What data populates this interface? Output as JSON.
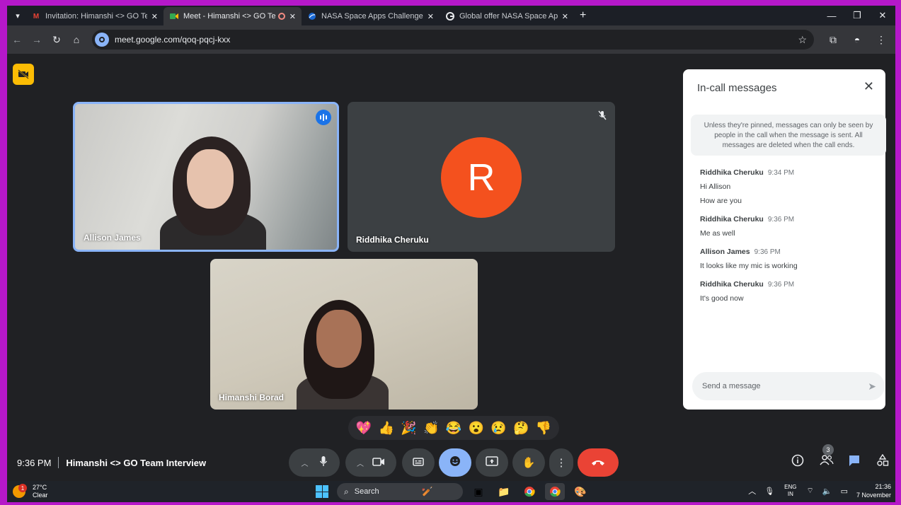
{
  "browser": {
    "tabs": [
      {
        "label": "Invitation: Himanshi <> GO Te",
        "icon": "gmail-icon",
        "active": false,
        "close": "✕"
      },
      {
        "label": "Meet - Himanshi <> GO Te",
        "icon": "meet-icon",
        "active": true,
        "close": "✕"
      },
      {
        "label": "NASA Space Apps Challenge",
        "icon": "nasa-icon",
        "active": false,
        "close": "✕"
      },
      {
        "label": "Global offer NASA Space Apps",
        "icon": "google-icon",
        "active": false,
        "close": "✕"
      }
    ],
    "url": "meet.google.com/qoq-pqcj-kxx"
  },
  "meet": {
    "participants": [
      {
        "name": "Allison James",
        "status": "speaking"
      },
      {
        "name": "Riddhika Cheruku",
        "status": "muted",
        "avatar_letter": "R",
        "avatar_color": "#f4511e"
      },
      {
        "name": "Himanshi Borad",
        "status": "camera-on"
      }
    ],
    "reactions": [
      "💖",
      "👍",
      "🎉",
      "👏",
      "😂",
      "😮",
      "😢",
      "🤔",
      "👎"
    ],
    "time": "9:36 PM",
    "meeting_name": "Himanshi <> GO Team Interview",
    "people_count": "3",
    "accent_color": "#8ab4f8",
    "end_call_color": "#ea4335"
  },
  "chat": {
    "title": "In-call messages",
    "note": "Unless they're pinned, messages can only be seen by people in the call when the message is sent. All messages are deleted when the call ends.",
    "messages": [
      {
        "sender": "Riddhika Cheruku",
        "time": "9:34 PM",
        "lines": [
          "Hi Allison",
          "How are you"
        ]
      },
      {
        "sender": "Riddhika Cheruku",
        "time": "9:36 PM",
        "lines": [
          "Me as well"
        ]
      },
      {
        "sender": "Allison James",
        "time": "9:36 PM",
        "lines": [
          "It looks like my mic is working"
        ]
      },
      {
        "sender": "Riddhika Cheruku",
        "time": "9:36 PM",
        "lines": [
          "It's good now"
        ]
      }
    ],
    "input_placeholder": "Send a message"
  },
  "taskbar": {
    "weather_temp": "27°C",
    "weather_desc": "Clear",
    "weather_alert": "1",
    "search_label": "Search",
    "lang_top": "ENG",
    "lang_bottom": "IN",
    "clock_time": "21:36",
    "clock_date": "7 November"
  }
}
